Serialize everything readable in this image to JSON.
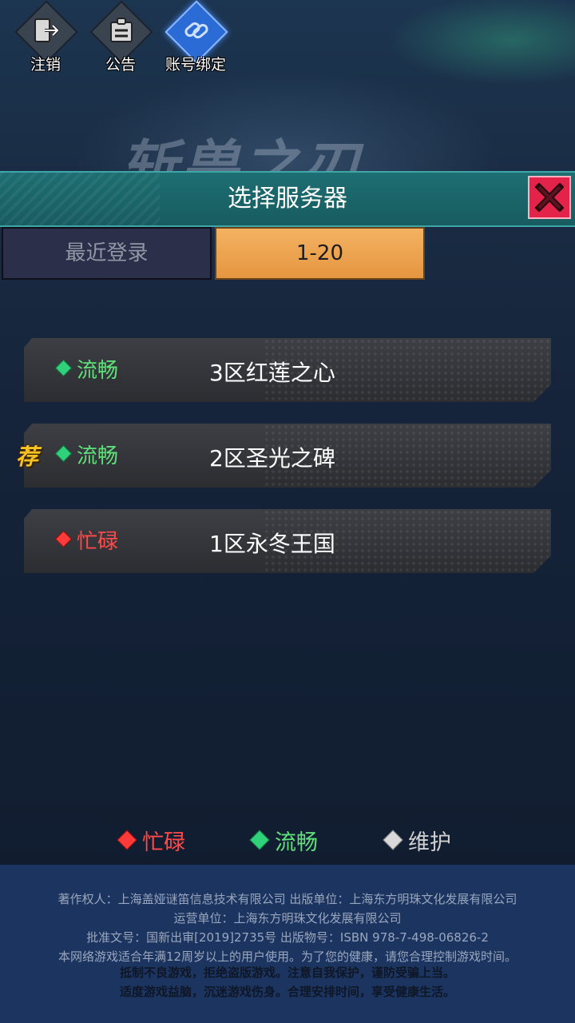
{
  "top_buttons": {
    "logout": {
      "label": "注销",
      "icon": "logout-icon"
    },
    "notice": {
      "label": "公告",
      "icon": "notice-icon"
    },
    "bind": {
      "label": "账号绑定",
      "icon": "link-icon"
    }
  },
  "background": {
    "logo_text": "斩兽之刃"
  },
  "dialog": {
    "title": "选择服务器",
    "close_icon": "close-icon"
  },
  "tabs": [
    {
      "label": "最近登录",
      "active": false
    },
    {
      "label": "1-20",
      "active": true
    }
  ],
  "servers": [
    {
      "status": "流畅",
      "status_color": "#5fe07a",
      "name": "3区红莲之心",
      "recommended": false
    },
    {
      "status": "流畅",
      "status_color": "#5fe07a",
      "name": "2区圣光之碑",
      "recommended": true,
      "badge": "荐"
    },
    {
      "status": "忙碌",
      "status_color": "#ff4a4a",
      "name": "1区永冬王国",
      "recommended": false
    }
  ],
  "legend": [
    {
      "label": "忙碌",
      "color": "#ff4a4a"
    },
    {
      "label": "流畅",
      "color": "#5fe07a"
    },
    {
      "label": "维护",
      "color": "#d0d0d0"
    }
  ],
  "footer": {
    "line1": "著作权人：上海盖娅谜笛信息技术有限公司 出版单位：上海东方明珠文化发展有限公司",
    "line2": "运营单位：上海东方明珠文化发展有限公司",
    "line3": "批准文号：国新出审[2019]2735号 出版物号：ISBN 978-7-498-06826-2",
    "line4": "本网络游戏适合年满12周岁以上的用户使用。为了您的健康，请您合理控制游戏时间。",
    "line5": "抵制不良游戏，拒绝盗版游戏。注意自我保护，谨防受骗上当。",
    "line6": "适度游戏益脑，沉迷游戏伤身。合理安排时间，享受健康生活。"
  }
}
